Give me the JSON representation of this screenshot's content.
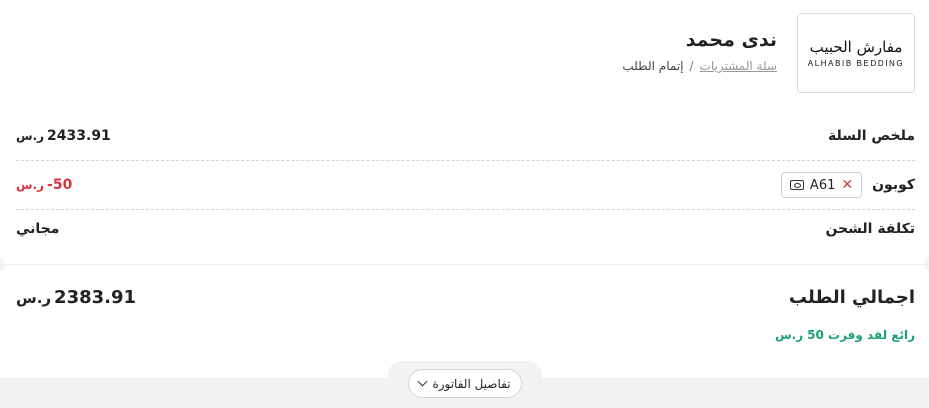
{
  "header": {
    "logo_ar": "مفارش الحبيب",
    "logo_en": "ALHABIB BEDDING",
    "store_name": "ندى محمد",
    "breadcrumb": {
      "link": "سلة المشتريات",
      "separator": "/",
      "current": "إتمام الطلب"
    }
  },
  "summary": {
    "cart_label": "ملخص السلة",
    "cart_value": "2433.91",
    "coupon_label": "كوبون",
    "coupon_code": "A61",
    "coupon_value": "-50",
    "shipping_label": "تكلفة الشحن",
    "shipping_value": "مجاني",
    "currency_symbol": "ر.س"
  },
  "total": {
    "label": "اجمالي الطلب",
    "value": "2383.91",
    "savings_text": "رائع لقد وفرت 50"
  },
  "details_button": {
    "label": "تفاصيل الفاتورة"
  },
  "colors": {
    "negative": "#d9343e",
    "savings": "#1aa07a"
  }
}
